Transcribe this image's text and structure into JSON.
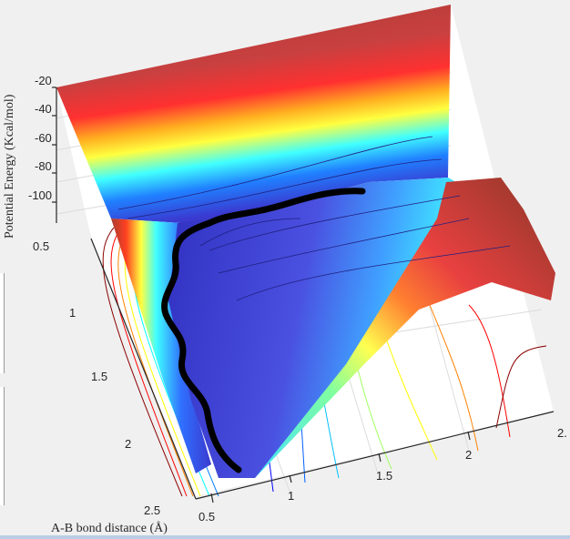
{
  "chart_data": {
    "type": "surface",
    "title": "",
    "zlabel": "Potential Energy (Kcal/mol)",
    "xlabel": "A-B bond distance (Å)",
    "ylabel": "",
    "z_ticks": [
      "-20",
      "-40",
      "-60",
      "-80",
      "-100"
    ],
    "x_ticks": [
      "0.5",
      "1",
      "1.5",
      "2",
      "2."
    ],
    "y_ticks": [
      "0.5",
      "1",
      "1.5",
      "2",
      "2.5"
    ],
    "zlim": [
      -110,
      -20
    ],
    "xlim": [
      0.5,
      2.5
    ],
    "ylim": [
      0.5,
      2.5
    ],
    "colormap": "jet",
    "contours_on_floor": true,
    "trajectory_color": "#000000",
    "grid": true
  }
}
